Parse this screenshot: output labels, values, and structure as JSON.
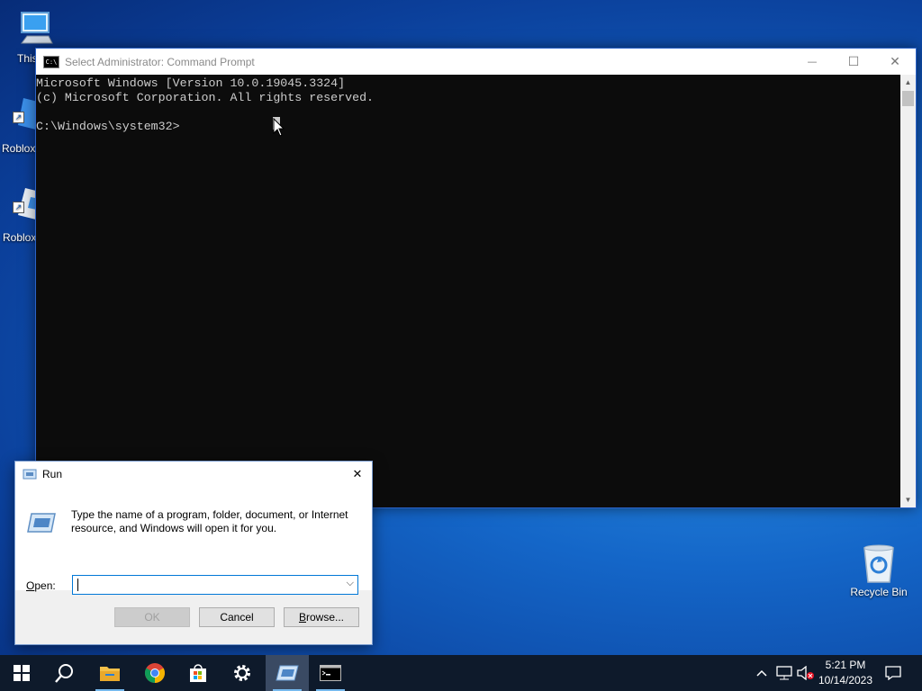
{
  "desktop": {
    "icons": [
      {
        "label": "This"
      },
      {
        "label": "Roblox"
      },
      {
        "label": "Roblox"
      },
      {
        "label": "Recycle Bin"
      }
    ]
  },
  "cmd": {
    "title": "Select Administrator: Command Prompt",
    "title_icon_text": "C:\\",
    "lines": [
      "Microsoft Windows [Version 10.0.19045.3324]",
      "(c) Microsoft Corporation. All rights reserved.",
      "",
      "C:\\Windows\\system32>"
    ],
    "controls": {
      "minimize": "—",
      "maximize": "☐",
      "close": "✕"
    }
  },
  "run": {
    "title": "Run",
    "description": "Type the name of a program, folder, document, or Internet resource, and Windows will open it for you.",
    "open_label_underlined": "O",
    "open_label_rest": "pen:",
    "input_value": "",
    "buttons": {
      "ok": "OK",
      "cancel": "Cancel",
      "browse_underlined": "B",
      "browse_rest": "rowse..."
    }
  },
  "taskbar": {
    "items": [
      "start",
      "search",
      "file-explorer",
      "chrome",
      "microsoft-store",
      "settings",
      "run",
      "command-prompt"
    ],
    "clock_time": "5:21 PM",
    "clock_date": "10/14/2023"
  },
  "colors": {
    "accent": "#0078d7",
    "taskbar": "#0e1a2b",
    "console_bg": "#0c0c0c",
    "console_fg": "#cccccc"
  }
}
